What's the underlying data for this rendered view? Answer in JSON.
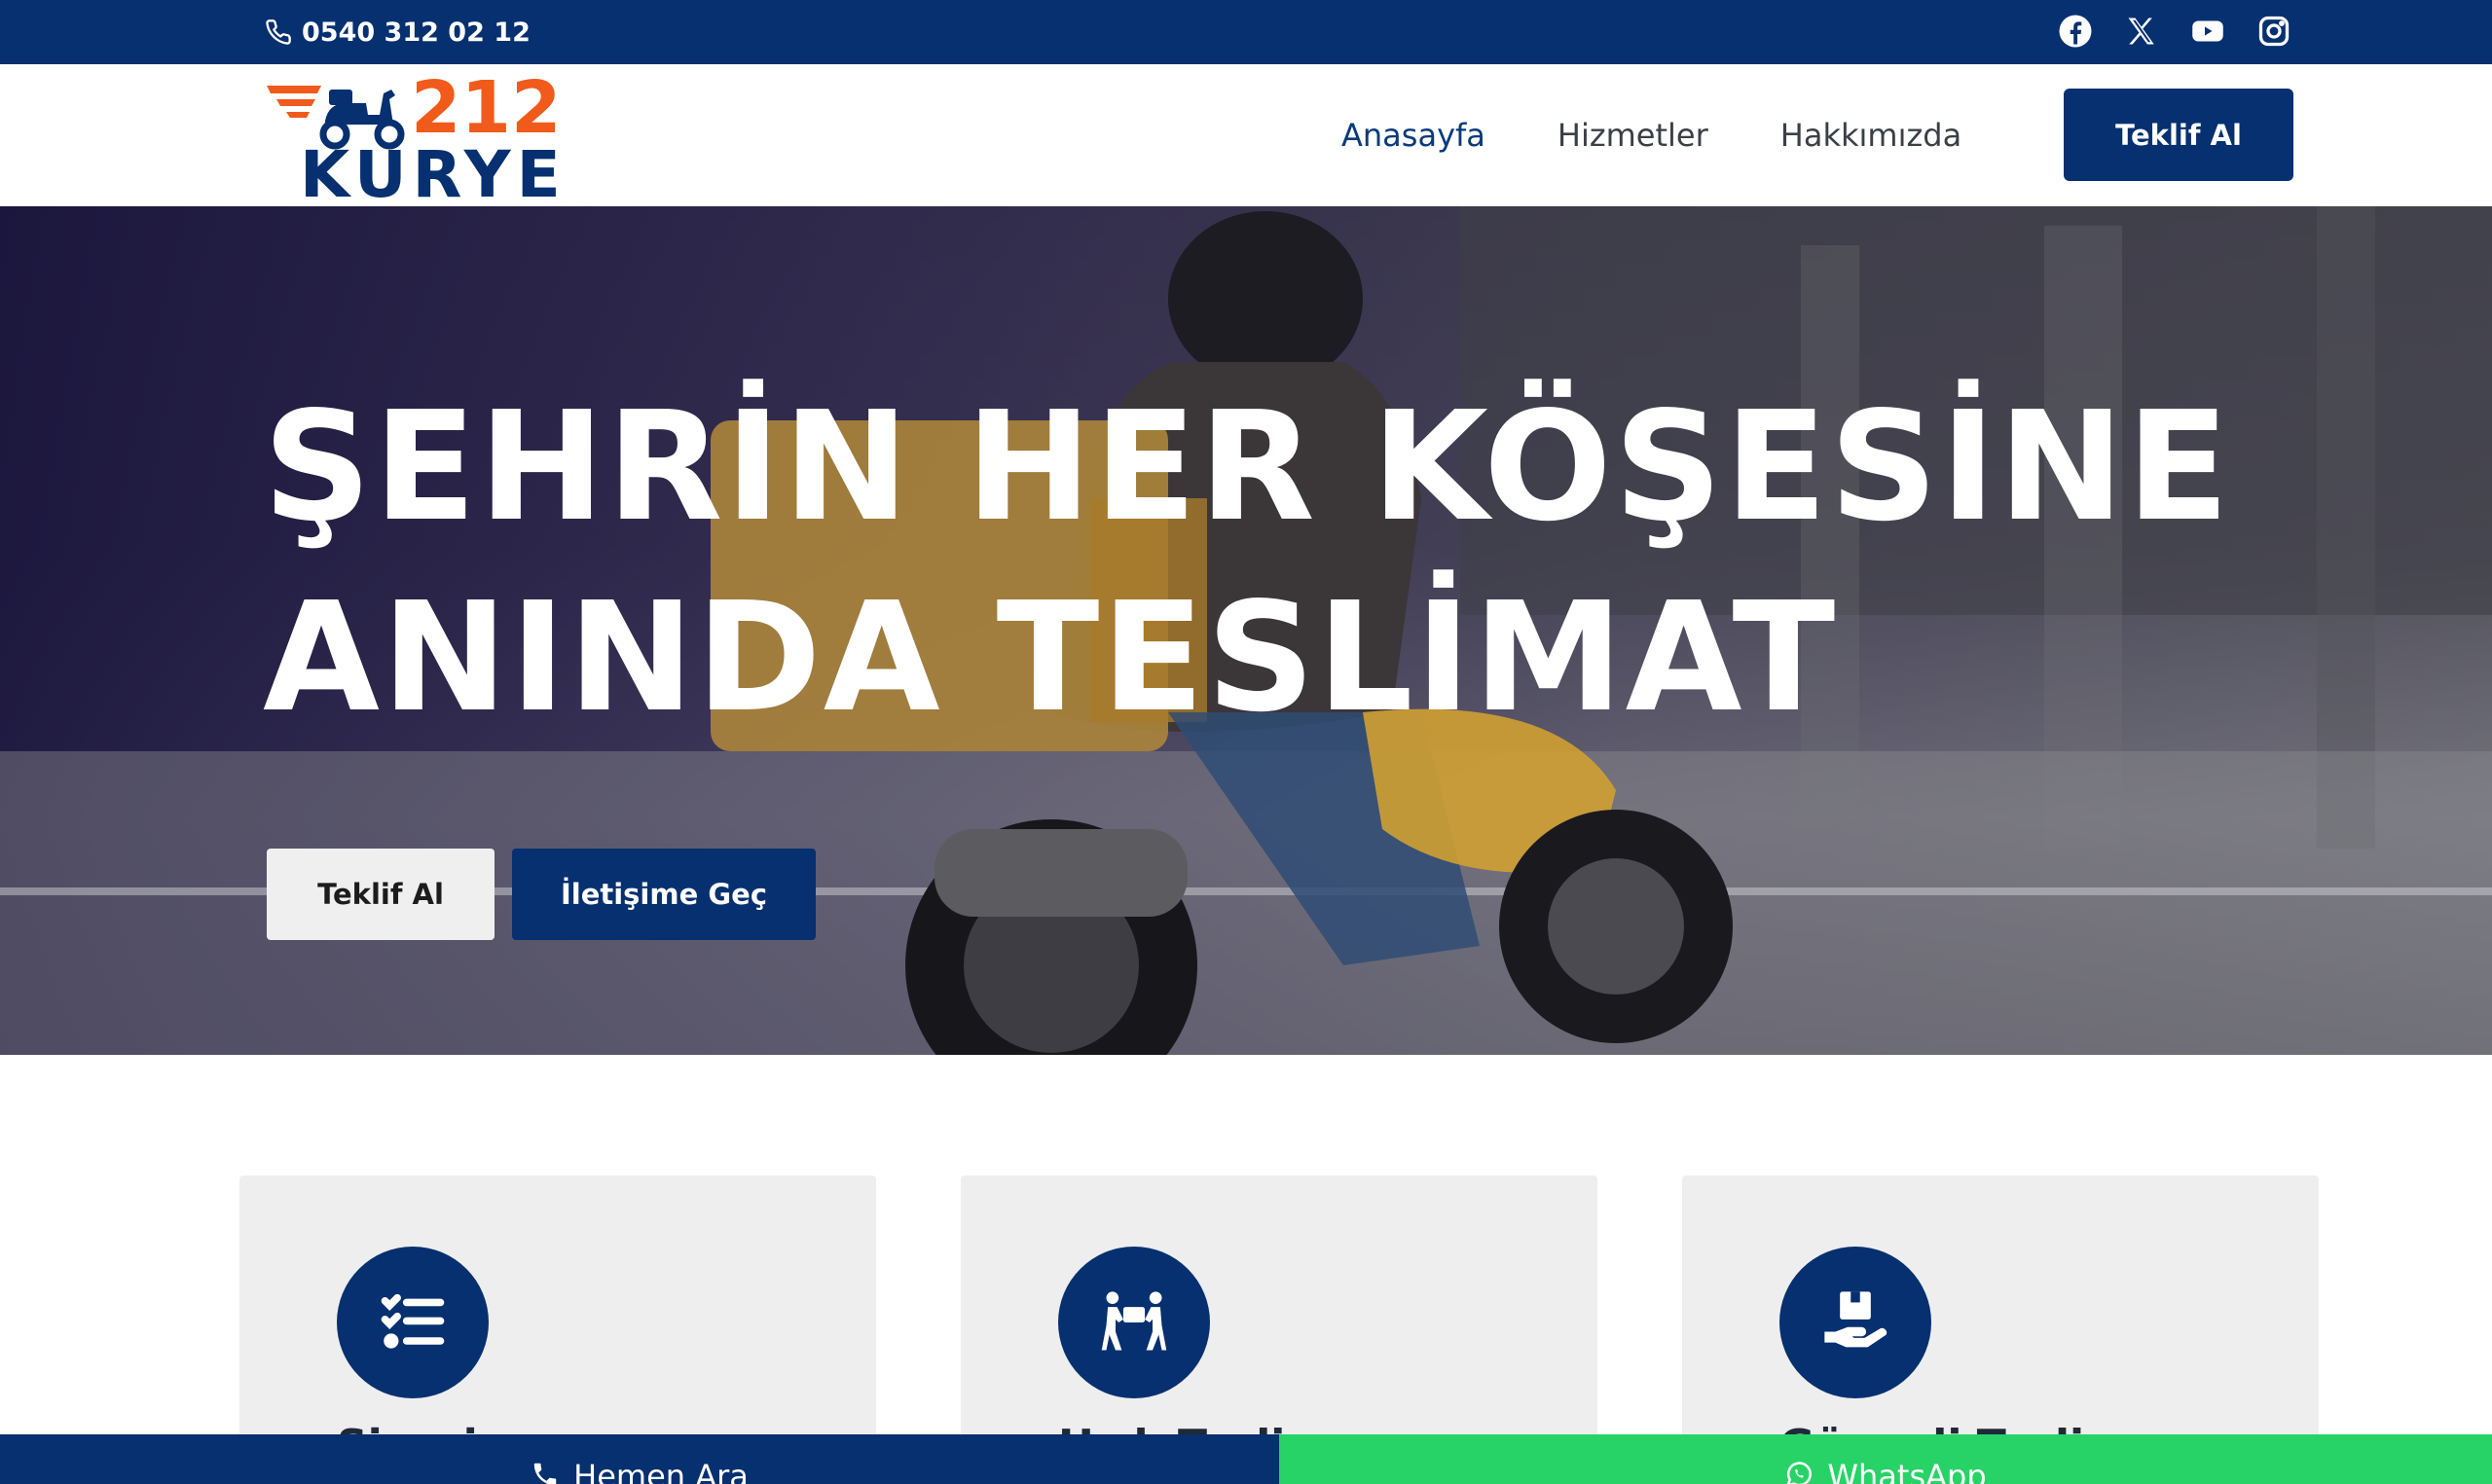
{
  "topbar": {
    "phone": "0540 312 02 12",
    "socials": [
      "facebook-icon",
      "x-twitter-icon",
      "youtube-icon",
      "instagram-icon"
    ],
    "background": "#06306f"
  },
  "logo": {
    "number": "212",
    "word": "KURYE",
    "number_color": "#f05a1a",
    "word_color": "#06306f"
  },
  "nav": {
    "items": [
      {
        "label": "Anasayfa",
        "active": true
      },
      {
        "label": "Hizmetler",
        "active": false
      },
      {
        "label": "Hakkımızda",
        "active": false
      }
    ],
    "cta": "Teklif Al"
  },
  "hero": {
    "title_line1": "ŞEHRİN HER KÖŞESİNE",
    "title_line2": "ANINDA TESLİMAT",
    "button_primary": "Teklif Al",
    "button_secondary": "İletişime Geç"
  },
  "cards": [
    {
      "icon": "checklist-icon",
      "title": "Si̇pari̇ş"
    },
    {
      "icon": "people-carry-icon",
      "title": "Hızlı Teslim"
    },
    {
      "icon": "hand-box-icon",
      "title": "Güvenli Teslim"
    }
  ],
  "bottom_bar": {
    "call_label": "Hemen Ara",
    "whatsapp_label": "WhatsApp",
    "call_color": "#06306f",
    "whatsapp_color": "#27d366"
  }
}
